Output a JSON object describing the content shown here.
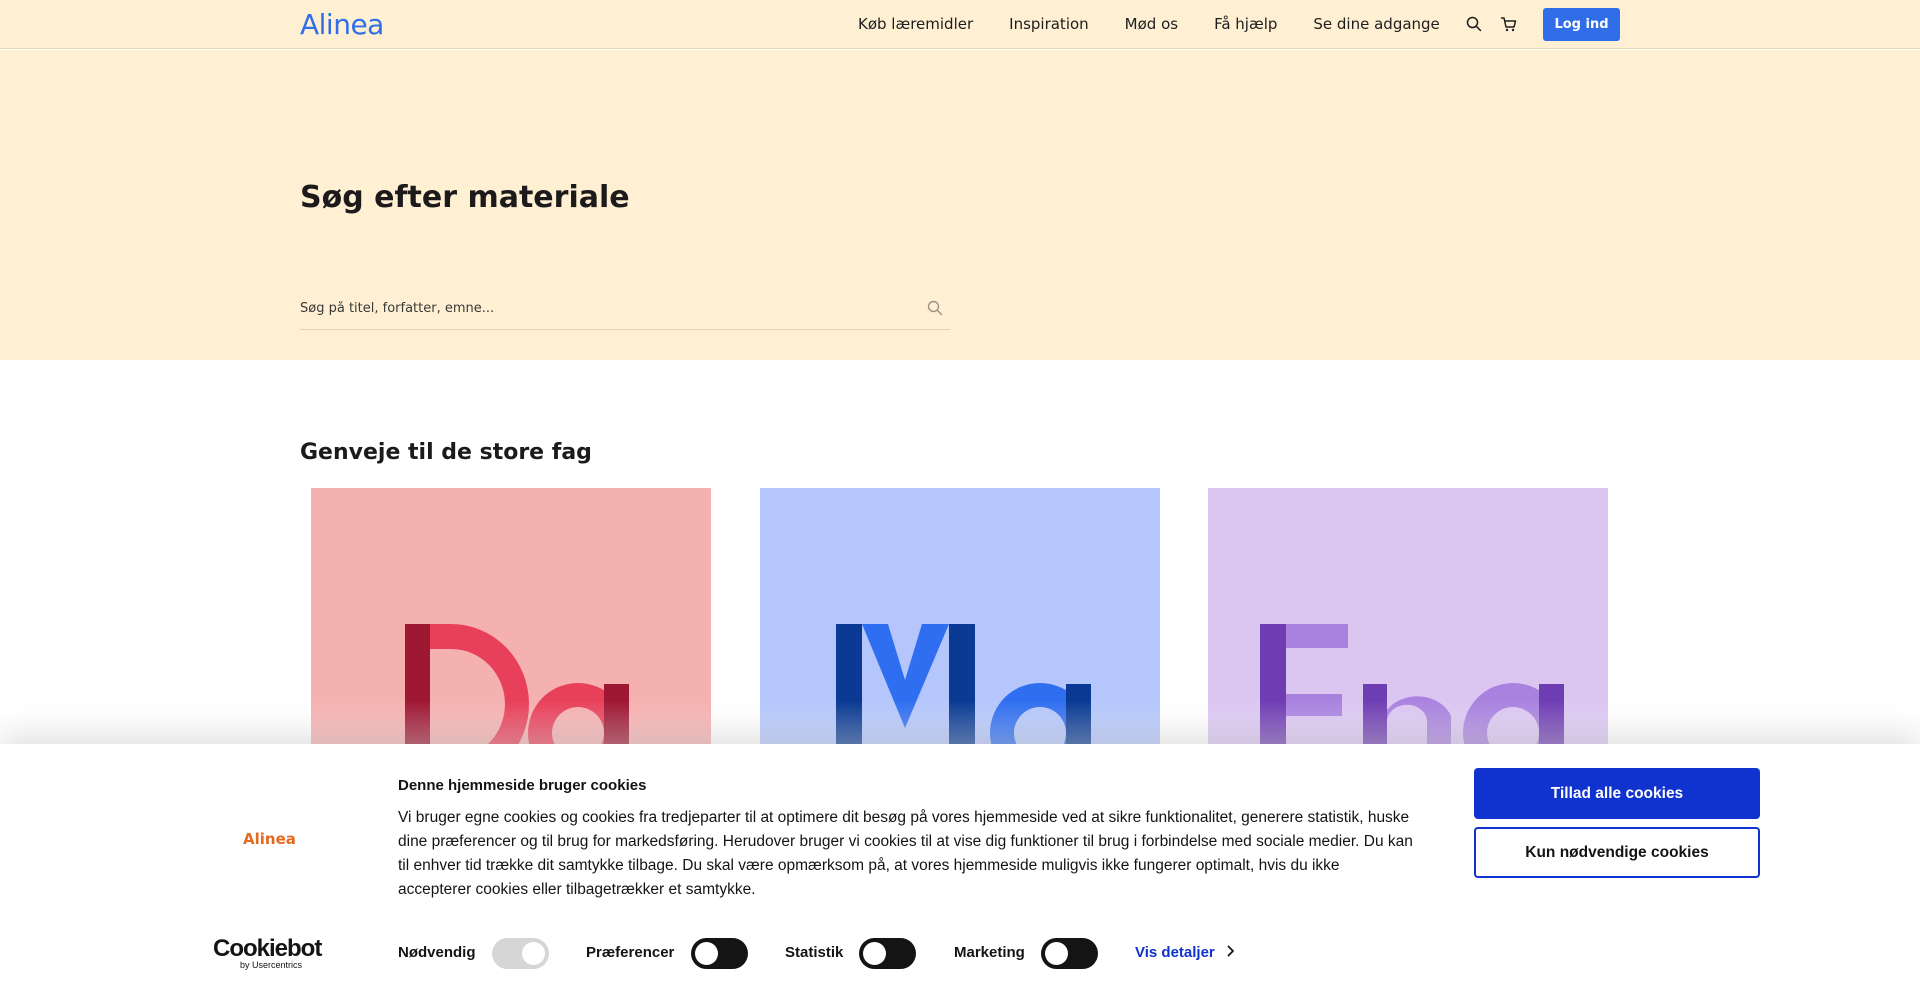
{
  "header": {
    "logo": "Alinea",
    "nav": [
      "Køb læremidler",
      "Inspiration",
      "Mød os",
      "Få hjælp",
      "Se dine adgange"
    ],
    "login_label": "Log ind"
  },
  "hero": {
    "title": "Søg efter materiale",
    "search_placeholder": "Søg på titel, forfatter, emne..."
  },
  "section": {
    "title": "Genveje til de store fag"
  },
  "cards": [
    {
      "letters": "Da",
      "bg": "#f5b0b0",
      "dark": "#9e1733",
      "light": "#e8405a"
    },
    {
      "letters": "Ma",
      "bg": "#b4c6fb",
      "dark": "#0a3a93",
      "light": "#2f6ef0"
    },
    {
      "letters": "Eng",
      "bg": "#dbc6f2",
      "dark": "#6f3db3",
      "light": "#a982df"
    }
  ],
  "cookie": {
    "logo": "Alinea",
    "title": "Denne hjemmeside bruger cookies",
    "text": "Vi bruger egne cookies og cookies fra tredjeparter til at optimere dit besøg på vores hjemmeside ved at sikre funktionalitet, generere statistik, huske dine præferencer og til brug for markedsføring. Herudover bruger vi cookies til at vise dig funktioner til brug i forbindelse med sociale medier. Du kan til enhver tid trække dit samtykke tilbage. Du skal være opmærksom på, at vores hjemmeside muligvis ikke fungerer optimalt, hvis du ikke accepterer cookies eller tilbagetrækker et samtykke.",
    "allow_all": "Tillad alle cookies",
    "necessary_only": "Kun nødvendige cookies",
    "cookiebot_word": "Cookiebot",
    "cookiebot_by": "by Usercentrics",
    "categories": [
      "Nødvendig",
      "Præferencer",
      "Statistik",
      "Marketing"
    ],
    "details_label": "Vis detaljer"
  }
}
